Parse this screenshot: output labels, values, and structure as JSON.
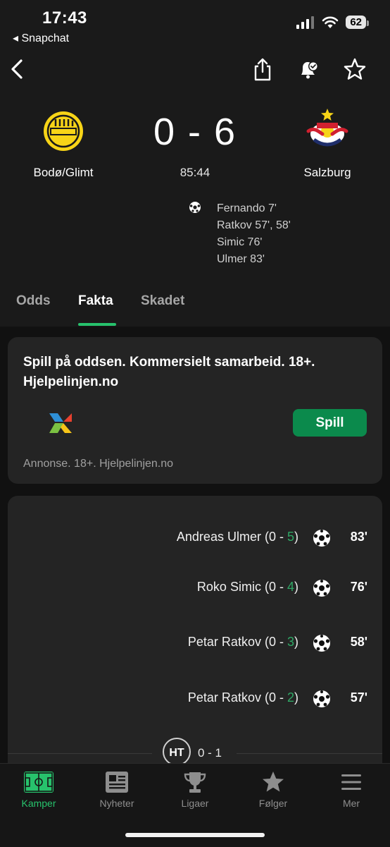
{
  "status_bar": {
    "time": "17:43",
    "back_app": "◂ Snapchat",
    "battery": "62"
  },
  "match": {
    "home_team": "Bodø/Glimt",
    "away_team": "Salzburg",
    "score": "0 - 6",
    "clock": "85:44",
    "home_logo_text": "BODØ 1916",
    "away_logo_text": "Red Bull SALZBURG",
    "scorers": [
      "Fernando 7'",
      "Ratkov 57', 58'",
      "Simic 76'",
      "Ulmer 83'"
    ]
  },
  "tabs": [
    {
      "label": "Odds",
      "active": false
    },
    {
      "label": "Fakta",
      "active": true
    },
    {
      "label": "Skadet",
      "active": false
    }
  ],
  "ad": {
    "title": "Spill på oddsen. Kommersielt samarbeid. 18+. Hjelpelinjen.no",
    "button_label": "Spill",
    "footer": "Annonse. 18+. Hjelpelinjen.no"
  },
  "events": [
    {
      "player": "Andreas Ulmer",
      "score_prefix": "(0 - ",
      "score_highlight": "5",
      "score_suffix": ")",
      "minute": "83'"
    },
    {
      "player": "Roko Simic",
      "score_prefix": "(0 - ",
      "score_highlight": "4",
      "score_suffix": ")",
      "minute": "76'"
    },
    {
      "player": "Petar Ratkov",
      "score_prefix": "(0 - ",
      "score_highlight": "3",
      "score_suffix": ")",
      "minute": "58'"
    },
    {
      "player": "Petar Ratkov",
      "score_prefix": "(0 - ",
      "score_highlight": "2",
      "score_suffix": ")",
      "minute": "57'"
    }
  ],
  "halftime": {
    "badge": "HT",
    "score": "0 - 1"
  },
  "nav": [
    {
      "label": "Kamper",
      "icon": "pitch-icon",
      "active": true
    },
    {
      "label": "Nyheter",
      "icon": "newspaper-icon",
      "active": false
    },
    {
      "label": "Ligaer",
      "icon": "trophy-icon",
      "active": false
    },
    {
      "label": "Følger",
      "icon": "star-icon",
      "active": false
    },
    {
      "label": "Mer",
      "icon": "menu-icon",
      "active": false
    }
  ],
  "colors": {
    "accent": "#27c26c",
    "button": "#0b8a4c",
    "card": "#242424",
    "background": "#1a1a1a"
  }
}
